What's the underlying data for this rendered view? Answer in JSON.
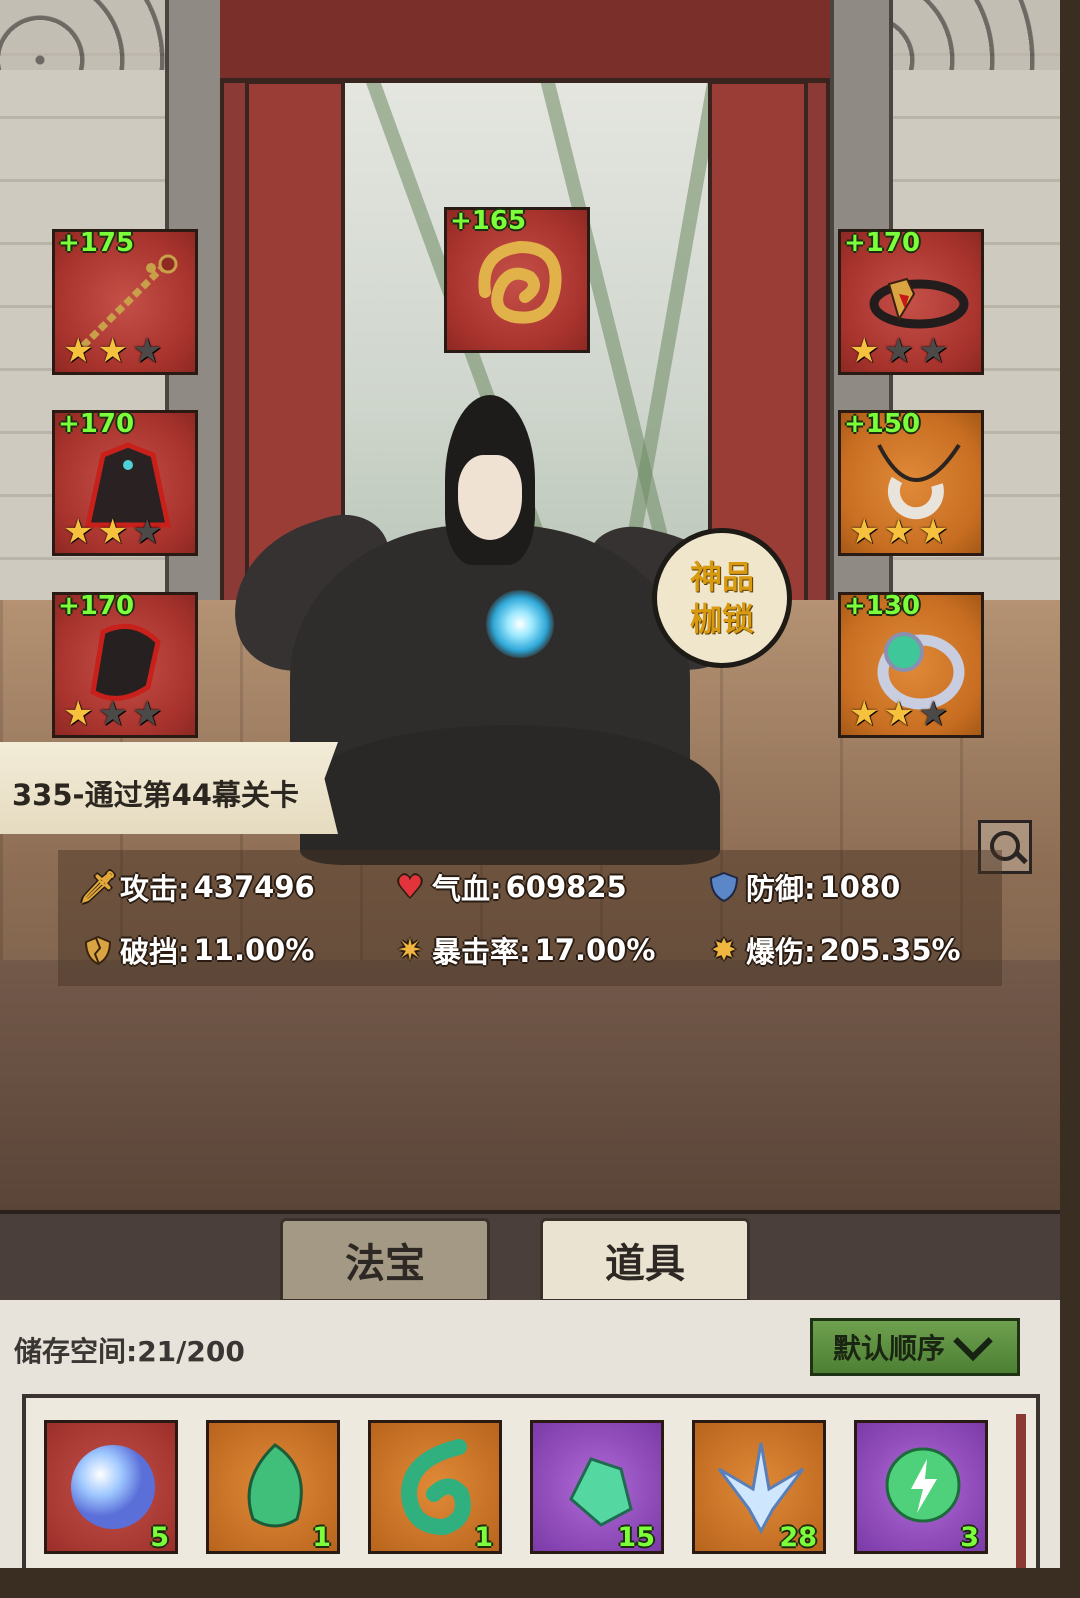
{
  "equipment": [
    {
      "slot": "weapon",
      "bonus": "+175",
      "stars": 2,
      "max_stars": 3,
      "rarity": "red",
      "icon": "chain-spear-icon"
    },
    {
      "slot": "armor",
      "bonus": "+170",
      "stars": 2,
      "max_stars": 3,
      "rarity": "red",
      "icon": "robe-icon"
    },
    {
      "slot": "boots",
      "bonus": "+170",
      "stars": 1,
      "max_stars": 3,
      "rarity": "red",
      "icon": "boots-icon"
    },
    {
      "slot": "artifact",
      "bonus": "+165",
      "rarity": "red",
      "icon": "golden-swirl-icon"
    },
    {
      "slot": "headband",
      "bonus": "+170",
      "stars": 1,
      "max_stars": 3,
      "rarity": "red",
      "icon": "headband-icon"
    },
    {
      "slot": "necklace",
      "bonus": "+150",
      "stars": 3,
      "max_stars": 3,
      "rarity": "orange",
      "icon": "necklace-icon"
    },
    {
      "slot": "ring",
      "bonus": "+130",
      "stars": 2,
      "max_stars": 3,
      "rarity": "orange",
      "icon": "ring-icon"
    }
  ],
  "badge": {
    "line1": "神品",
    "line2": "枷锁"
  },
  "stage": {
    "label": "335-通过第44幕关卡"
  },
  "stats": {
    "attack": {
      "label": "攻击:",
      "value": "437496",
      "icon": "sword-icon"
    },
    "hp": {
      "label": "气血:",
      "value": "609825",
      "icon": "heart-icon"
    },
    "defense": {
      "label": "防御:",
      "value": "1080",
      "icon": "shield-icon"
    },
    "pierce": {
      "label": "破挡:",
      "value": "11.00%",
      "icon": "broken-shield-icon"
    },
    "crit_rate": {
      "label": "暴击率:",
      "value": "17.00%",
      "icon": "crit-icon"
    },
    "crit_damage": {
      "label": "爆伤:",
      "value": "205.35%",
      "icon": "crit-damage-icon"
    }
  },
  "tabs": [
    {
      "label": "法宝",
      "active": false
    },
    {
      "label": "道具",
      "active": true
    }
  ],
  "bag": {
    "storage_label": "储存空间:",
    "storage_value": "21/200",
    "sort_label": "默认顺序",
    "items": [
      {
        "name": "blue-orb",
        "count": "5",
        "rarity": "red",
        "icon": "crystal-orb-icon"
      },
      {
        "name": "jade-leaf",
        "count": "1",
        "rarity": "orange",
        "icon": "jade-leaf-icon"
      },
      {
        "name": "jade-swirl",
        "count": "1",
        "rarity": "orange",
        "icon": "jade-swirl-icon"
      },
      {
        "name": "green-crystal",
        "count": "15",
        "rarity": "purple",
        "icon": "green-crystal-icon"
      },
      {
        "name": "ice-crystal",
        "count": "28",
        "rarity": "orange",
        "icon": "ice-crystal-icon"
      },
      {
        "name": "thunder-orb",
        "count": "3",
        "rarity": "purple",
        "icon": "thunder-orb-icon"
      }
    ]
  },
  "colors": {
    "bonus_text": "#7cff3a",
    "star_on": "#f6c13c",
    "star_off": "#4c4a48",
    "sort_button": "#5e9040",
    "badge_text": "#d89a10"
  }
}
